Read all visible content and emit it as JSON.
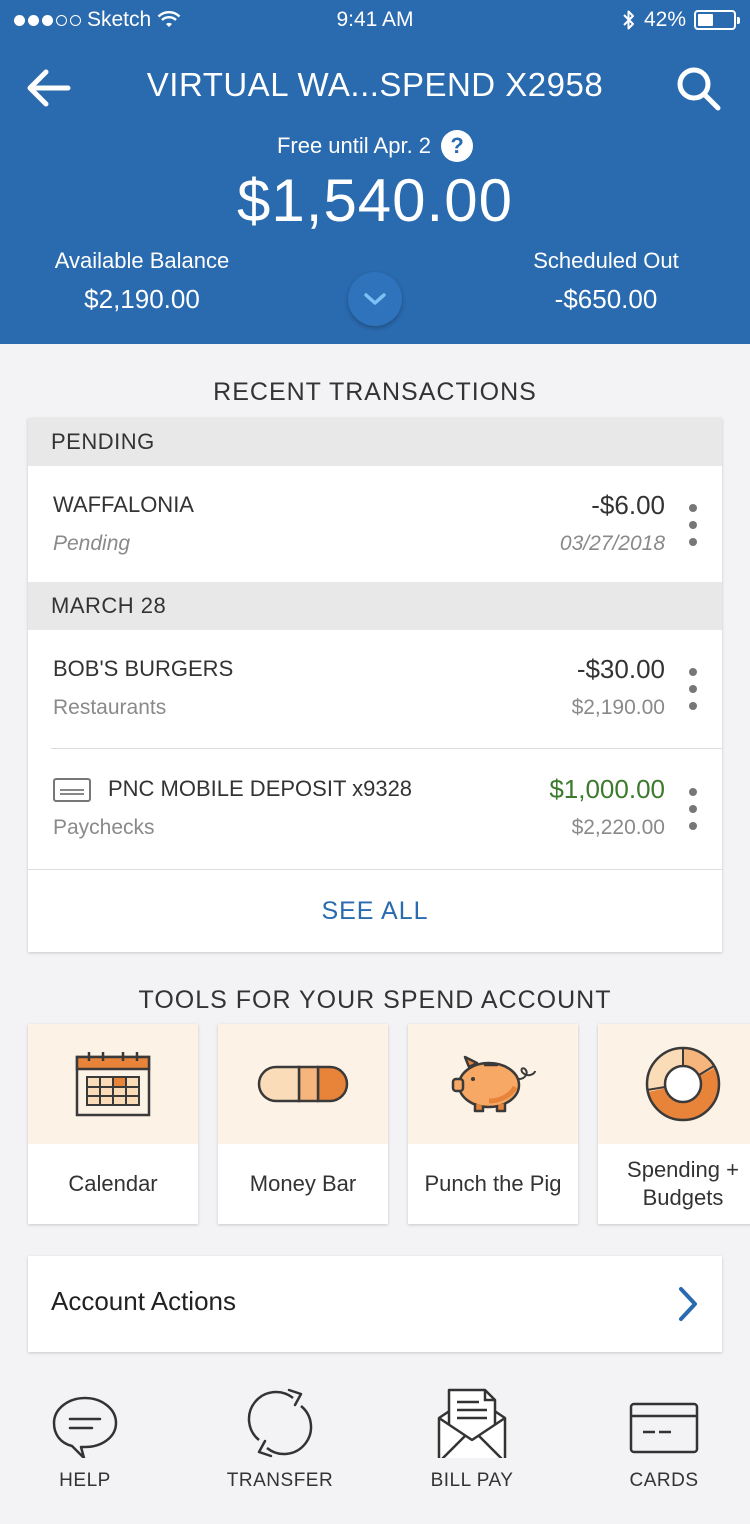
{
  "status_bar": {
    "carrier": "Sketch",
    "time": "9:41 AM",
    "battery_pct": "42%"
  },
  "header": {
    "title": "VIRTUAL WA...SPEND X2958",
    "free_until": "Free until Apr. 2",
    "help_glyph": "?",
    "balance": "$1,540.00",
    "available_label": "Available Balance",
    "available_value": "$2,190.00",
    "scheduled_label": "Scheduled Out",
    "scheduled_value": "-$650.00"
  },
  "transactions": {
    "title": "RECENT TRANSACTIONS",
    "groups": [
      {
        "label": "PENDING",
        "items": [
          {
            "name": "WAFFALONIA",
            "sub": "Pending",
            "amount": "-$6.00",
            "detail": "03/27/2018"
          }
        ]
      },
      {
        "label": "MARCH 28",
        "items": [
          {
            "name": "BOB'S BURGERS",
            "sub": "Restaurants",
            "amount": "-$30.00",
            "detail": "$2,190.00"
          },
          {
            "name": "PNC MOBILE DEPOSIT x9328",
            "sub": "Paychecks",
            "amount": "$1,000.00",
            "detail": "$2,220.00"
          }
        ]
      }
    ],
    "see_all": "SEE ALL"
  },
  "tools": {
    "title": "TOOLS FOR YOUR SPEND ACCOUNT",
    "items": [
      {
        "label": "Calendar",
        "icon": "calendar-icon"
      },
      {
        "label": "Money Bar",
        "icon": "money-bar-icon"
      },
      {
        "label": "Punch the Pig",
        "icon": "piggy-bank-icon"
      },
      {
        "label": "Spending + Budgets",
        "icon": "donut-chart-icon"
      }
    ]
  },
  "account_actions": {
    "label": "Account Actions"
  },
  "bottom_nav": [
    {
      "label": "HELP",
      "icon": "chat-bubble-icon"
    },
    {
      "label": "TRANSFER",
      "icon": "transfer-icon"
    },
    {
      "label": "BILL PAY",
      "icon": "bill-envelope-icon"
    },
    {
      "label": "CARDS",
      "icon": "card-icon"
    }
  ],
  "colors": {
    "header_blue": "#2a6aae",
    "link_blue": "#2a6aae",
    "positive_green": "#3c7a2d",
    "tool_bg": "#fdf2e6",
    "accent_orange": "#e8833a"
  }
}
